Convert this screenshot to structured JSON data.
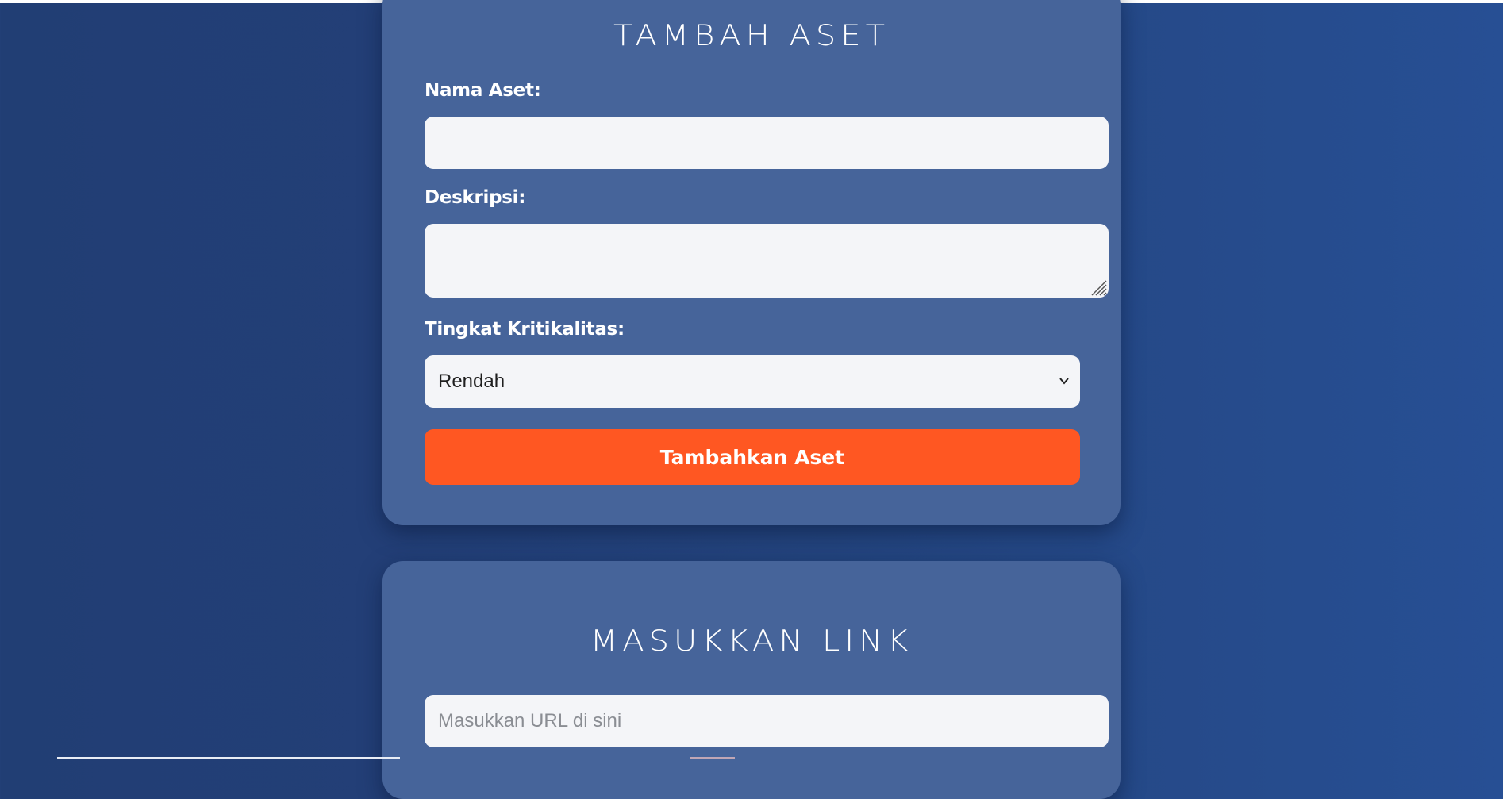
{
  "form_aset": {
    "title": "TAMBAH ASET",
    "nama_label": "Nama Aset:",
    "nama_value": "",
    "deskripsi_label": "Deskripsi:",
    "deskripsi_value": "",
    "kritikalitas_label": "Tingkat Kritikalitas:",
    "kritikalitas_selected": "Rendah",
    "submit_label": "Tambahkan Aset"
  },
  "form_link": {
    "title": "MASUKKAN LINK",
    "url_placeholder": "Masukkan URL di sini",
    "url_value": ""
  },
  "colors": {
    "background": "#23427a",
    "card": "#46649a",
    "field": "#f4f5f8",
    "accent_button": "#ff5722",
    "text": "#ffffff"
  },
  "icons": {
    "select_arrow": "chevron-down-icon",
    "textarea_grip": "resize-grip-icon"
  }
}
